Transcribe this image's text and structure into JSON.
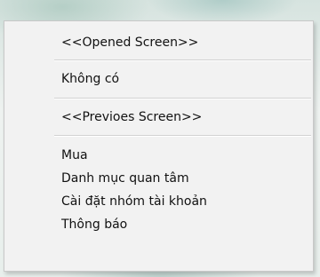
{
  "context_menu": {
    "opened_header": "<<Opened Screen>>",
    "opened_items": [
      "Không có"
    ],
    "previous_header": "<<Previoes Screen>>",
    "items": [
      "Mua",
      "Danh mục quan tâm",
      "Cài đặt nhóm tài khoản",
      "Thông báo"
    ]
  }
}
